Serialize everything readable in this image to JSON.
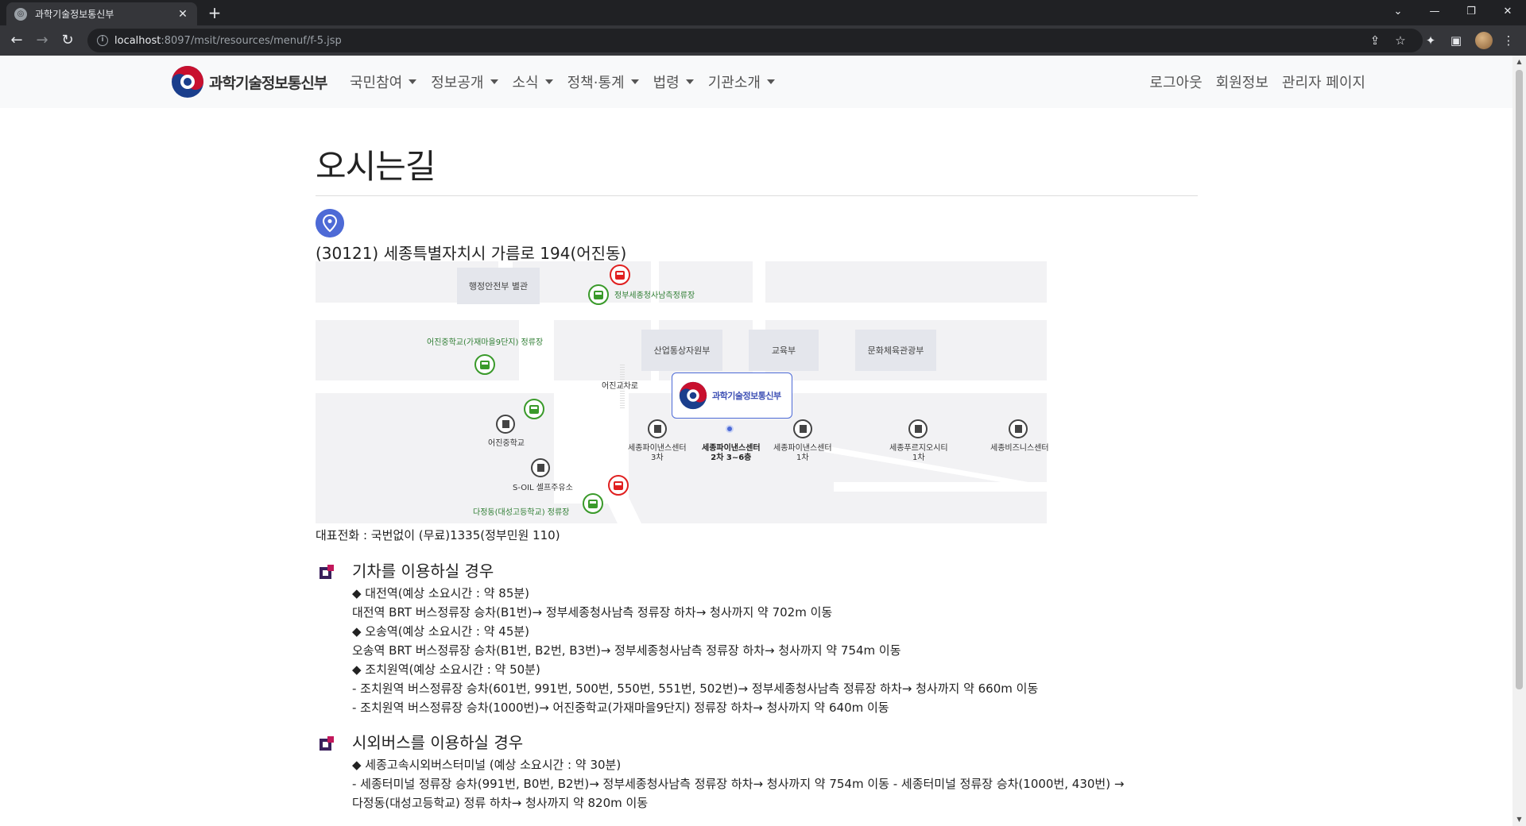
{
  "browser": {
    "tab_title": "과학기술정보통신부",
    "url_host": "localhost",
    "url_rest": ":8097/msit/resources/menuf/f-5.jsp"
  },
  "nav": {
    "logo_text": "과학기술정보통신부",
    "menu": [
      "국민참여",
      "정보공개",
      "소식",
      "정책·통계",
      "법령",
      "기관소개"
    ],
    "user_links": [
      "로그아웃",
      "회원정보",
      "관리자 페이지"
    ]
  },
  "page": {
    "title": "오시는길",
    "address": "(30121) 세종특별자치시 가름로 194(어진동)",
    "phone": "대표전화 : 국번없이 (무료)1335(정부민원 110)"
  },
  "map": {
    "buildings": {
      "mois": "행정안전부 별관",
      "motie": "산업통상자원부",
      "moe": "교육부",
      "mcst": "문화체육관광부"
    },
    "labels": {
      "stop_south": "정부세종청사남측정류장",
      "stop_eojin": "어진중학교(가재마을9단지) 정류장",
      "crossroad": "어진교차로",
      "school": "어진중학교",
      "soil": "S-OIL 셀프주유소",
      "stop_dajeong": "다정동(대성고등학교) 정류장",
      "fin3": "세종파이낸스센터\n3차",
      "fin2": "세종파이낸스센터\n2차 3~6층",
      "fin1": "세종파이낸스센터\n1차",
      "prugio": "세종푸르지오시티\n1차",
      "biz": "세종비즈니스센터"
    },
    "callout": "과학기술정보통신부"
  },
  "sections": [
    {
      "title": "기차를 이용하실 경우",
      "lines": [
        "◆ 대전역(예상 소요시간 : 약 85분)",
        "대전역 BRT 버스정류장 승차(B1번)→ 정부세종청사남측 정류장 하차→ 청사까지 약 702m 이동",
        "◆ 오송역(예상 소요시간 : 약 45분)",
        "오송역 BRT 버스정류장 승차(B1번, B2번, B3번)→ 정부세종청사남측 정류장 하차→ 청사까지 약 754m 이동",
        "◆ 조치원역(예상 소요시간 : 약 50분)",
        "- 조치원역 버스정류장 승차(601번, 991번, 500번, 550번, 551번, 502번)→ 정부세종청사남측 정류장 하차→ 청사까지 약 660m 이동",
        "- 조치원역 버스정류장 승차(1000번)→ 어진중학교(가재마을9단지) 정류장 하차→ 청사까지 약 640m 이동"
      ]
    },
    {
      "title": "시외버스를 이용하실 경우",
      "lines": [
        "◆ 세종고속시외버스터미널 (예상 소요시간 : 약 30분)",
        "- 세종터미널 정류장 승차(991번, B0번, B2번)→ 정부세종청사남측 정류장 하차→ 청사까지 약 754m 이동 - 세종터미널 정류장 승차(1000번, 430번) →",
        "다정동(대성고등학교) 정류 하차→ 청사까지 약 820m 이동"
      ]
    }
  ]
}
